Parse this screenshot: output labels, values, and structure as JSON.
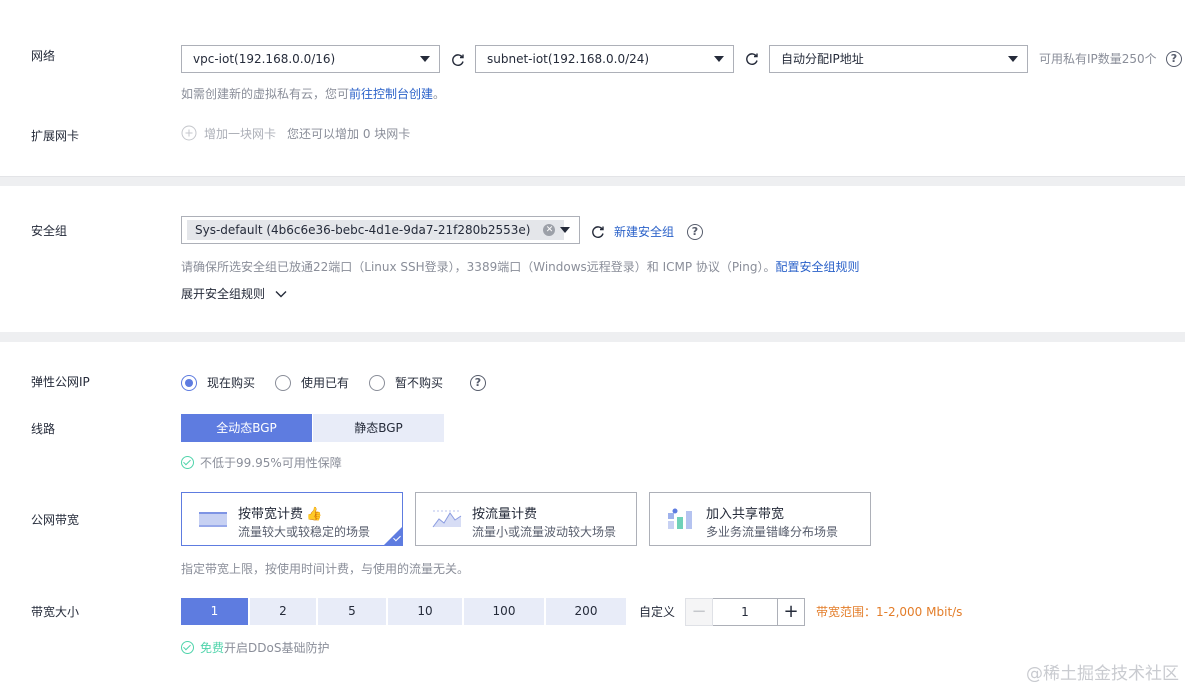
{
  "network": {
    "label": "网络",
    "vpc_value": "vpc-iot(192.168.0.0/16)",
    "subnet_value": "subnet-iot(192.168.0.0/24)",
    "ip_value": "自动分配IP地址",
    "available_ip": "可用私有IP数量250个",
    "hint_prefix": "如需创建新的虚拟私有云，您可",
    "hint_link": "前往控制台创建",
    "hint_suffix": "。"
  },
  "extended_nic": {
    "label": "扩展网卡",
    "add_label": "增加一块网卡",
    "remaining": "您还可以增加 0 块网卡"
  },
  "security_group": {
    "label": "安全组",
    "selected_tag": "Sys-default (4b6c6e36-bebc-4d1e-9da7-21f280b2553e)",
    "new_link": "新建安全组",
    "hint": "请确保所选安全组已放通22端口（Linux SSH登录），3389端口（Windows远程登录）和 ICMP 协议（Ping）。",
    "config_link": "配置安全组规则",
    "expand_label": "展开安全组规则"
  },
  "eip": {
    "label": "弹性公网IP",
    "options": [
      "现在购买",
      "使用已有",
      "暂不购买"
    ],
    "selected_index": 0
  },
  "line": {
    "label": "线路",
    "options": [
      "全动态BGP",
      "静态BGP"
    ],
    "selected_index": 0,
    "guarantee": "不低于99.95%可用性保障"
  },
  "bandwidth_billing": {
    "label": "公网带宽",
    "cards": [
      {
        "title": "按带宽计费",
        "desc": "流量较大或较稳定的场景",
        "icon": "bandwidth-chart-icon"
      },
      {
        "title": "按流量计费",
        "desc": "流量小或流量波动较大场景",
        "icon": "traffic-chart-icon"
      },
      {
        "title": "加入共享带宽",
        "desc": "多业务流量错峰分布场景",
        "icon": "shared-bandwidth-icon"
      }
    ],
    "selected_index": 0,
    "hint": "指定带宽上限，按使用时间计费，与使用的流量无关。"
  },
  "bandwidth_size": {
    "label": "带宽大小",
    "presets": [
      "1",
      "2",
      "5",
      "10",
      "100",
      "200"
    ],
    "selected_index": 0,
    "custom_label": "自定义",
    "value": "1",
    "range": "带宽范围：1-2,000 Mbit/s",
    "ddos_free": "免费",
    "ddos_text": "开启DDoS基础防护"
  },
  "watermark": "@稀土掘金技术社区",
  "colors": {
    "accent": "#5e7ce0",
    "link": "#2b62c9",
    "success": "#50d4ab",
    "warning": "#e37d29"
  }
}
